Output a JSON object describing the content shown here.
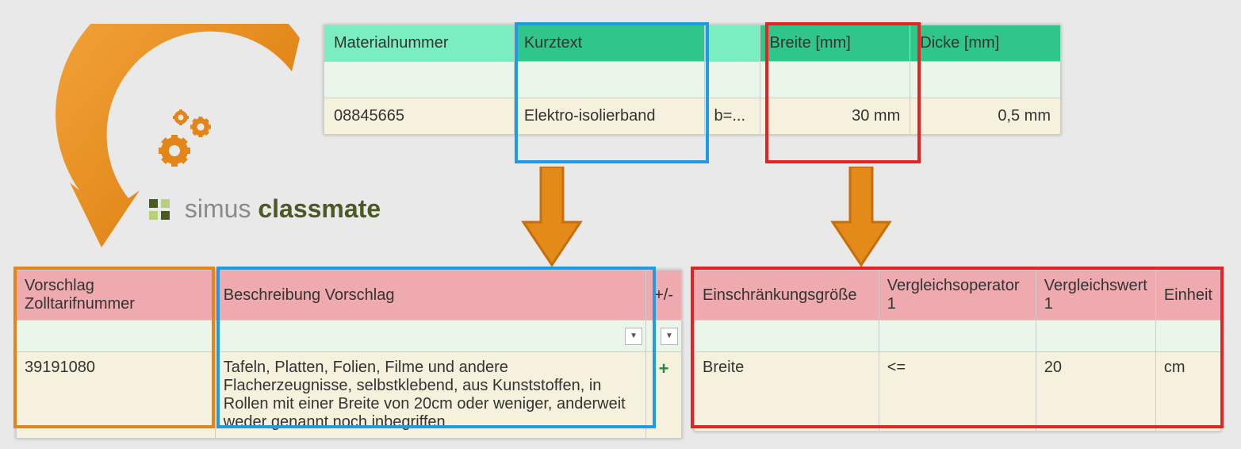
{
  "brand": {
    "part1": "simus",
    "part2": "classmate"
  },
  "top_table": {
    "headers": {
      "materialnummer": "Materialnummer",
      "kurztext": "Kurztext",
      "extra": "",
      "breite": "Breite [mm]",
      "dicke": "Dicke [mm]"
    },
    "row": {
      "materialnummer": "08845665",
      "kurztext": "Elektro-isolierband",
      "extra": "b=...",
      "breite": "30 mm",
      "dicke": "0,5 mm"
    }
  },
  "bl_table": {
    "headers": {
      "vorschlag": "Vorschlag Zolltarifnummer",
      "beschreibung": "Beschreibung Vorschlag",
      "pm": "+/-"
    },
    "row": {
      "vorschlag": "39191080",
      "beschreibung": "Tafeln, Platten, Folien, Filme und andere Flacherzeugnisse, selbstklebend, aus Kunststoffen, in Rollen mit einer Breite von 20cm oder weniger, anderweit weder genannt noch inbegriffen",
      "pm": "+"
    }
  },
  "br_table": {
    "headers": {
      "groesse": "Einschränkungsgröße",
      "op": "Vergleichsoperator 1",
      "wert": "Vergleichswert 1",
      "einheit": "Einheit"
    },
    "row": {
      "groesse": "Breite",
      "op": "<=",
      "wert": "20",
      "einheit": "cm"
    }
  },
  "colors": {
    "orange": "#e38518",
    "blue": "#1d9ce6",
    "red": "#e62222"
  }
}
